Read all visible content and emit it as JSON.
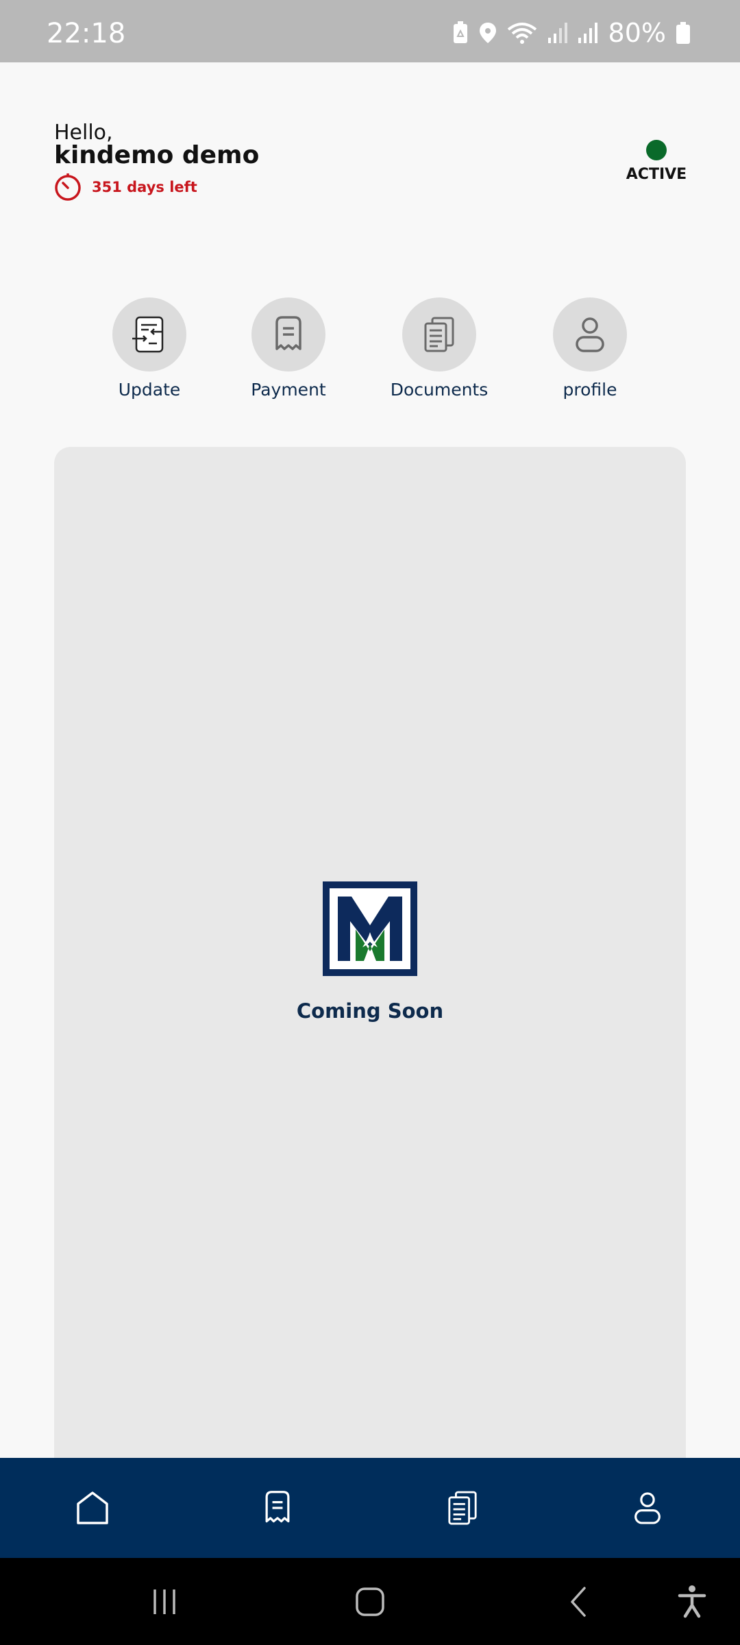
{
  "status_bar": {
    "time": "22:18",
    "battery": "80%",
    "icons": [
      "battery-saver-icon",
      "location-icon",
      "wifi-icon",
      "signal-icon",
      "signal-icon",
      "battery-icon"
    ]
  },
  "header": {
    "greeting": "Hello,",
    "username": "kindemo demo",
    "days_left": "351 days left",
    "status": "ACTIVE"
  },
  "quick_actions": [
    {
      "label": "Update",
      "icon": "update-doc-icon"
    },
    {
      "label": "Payment",
      "icon": "receipt-icon"
    },
    {
      "label": "Documents",
      "icon": "documents-icon"
    },
    {
      "label": "profile",
      "icon": "user-icon"
    }
  ],
  "content": {
    "message": "Coming Soon",
    "logo": "brand-logo"
  },
  "bottom_nav": [
    {
      "icon": "home-icon"
    },
    {
      "icon": "receipt-icon"
    },
    {
      "icon": "documents-icon"
    },
    {
      "icon": "user-icon"
    }
  ],
  "system_nav": [
    "recent-apps-icon",
    "home-button-icon",
    "back-icon",
    "accessibility-icon"
  ],
  "colors": {
    "primary": "#002d5b",
    "active": "#0a6a2a",
    "warning": "#c8161d",
    "logo_green": "#1a7a2e"
  }
}
